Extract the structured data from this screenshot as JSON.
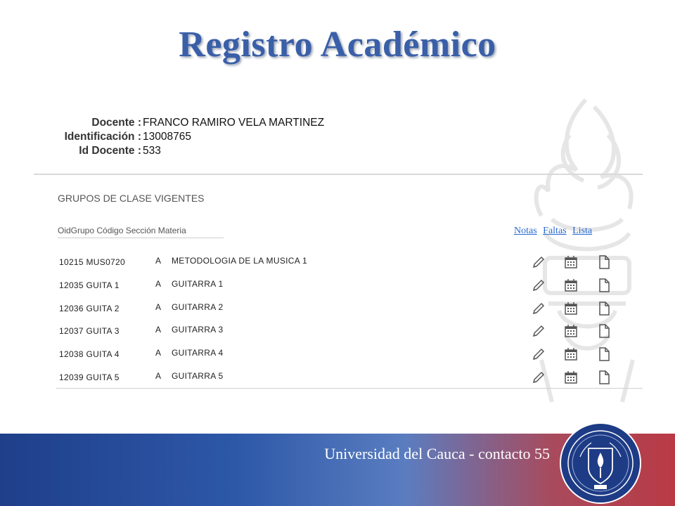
{
  "title": "Registro Académico",
  "teacher": {
    "docente_label": "Docente :",
    "docente_value": "FRANCO RAMIRO VELA MARTINEZ",
    "id_label": "Identificación :",
    "id_value": "13008765",
    "iddoc_label": "Id Docente :",
    "iddoc_value": "533"
  },
  "section_title": "GRUPOS DE CLASE VIGENTES",
  "columns_header": "OidGrupo Código Sección Materia",
  "actions": {
    "notas": "Notas",
    "faltas": "Faltas",
    "lista": "Lista"
  },
  "rows": [
    {
      "group": "10215 MUS0720",
      "section": "A",
      "subject": "METODOLOGIA DE LA MUSICA 1"
    },
    {
      "group": "12035 GUITA 1",
      "section": "A",
      "subject": "GUITARRA 1"
    },
    {
      "group": "12036 GUITA 2",
      "section": "A",
      "subject": "GUITARRA 2"
    },
    {
      "group": "12037 GUITA 3",
      "section": "A",
      "subject": "GUITARRA 3"
    },
    {
      "group": "12038 GUITA 4",
      "section": "A",
      "subject": "GUITARRA 4"
    },
    {
      "group": "12039 GUITA 5",
      "section": "A",
      "subject": "GUITARRA 5"
    }
  ],
  "icons": {
    "notes": "pencil-icon",
    "absences": "calendar-icon",
    "list": "document-icon"
  },
  "footer": {
    "text": "Universidad del Cauca  - contacto 55"
  },
  "colors": {
    "title": "#3a5fa8",
    "link": "#2a6bd1",
    "footer_blue": "#1f3f8a",
    "footer_red": "#b93a45",
    "seal": "#1e3b86"
  }
}
